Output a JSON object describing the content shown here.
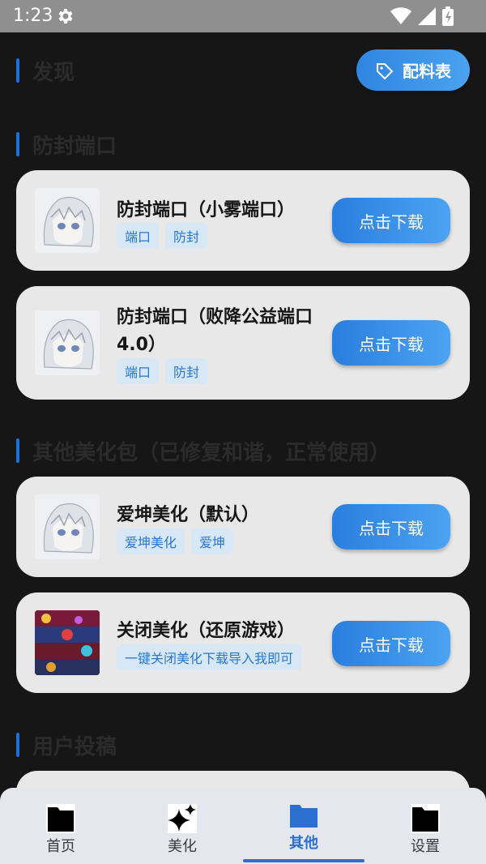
{
  "status_bar": {
    "time": "1:23",
    "icons": [
      "gear-icon",
      "wifi-icon",
      "signal-icon",
      "battery-icon"
    ]
  },
  "header": {
    "title": "发现",
    "formula_button": "配料表"
  },
  "sections": [
    {
      "title": "防封端口",
      "cards": [
        {
          "title": "防封端口（小雾端口）",
          "tags": [
            "端口",
            "防封"
          ],
          "button": "点击下载"
        },
        {
          "title": "防封端口（败降公益端口4.0）",
          "tags": [
            "端口",
            "防封"
          ],
          "button": "点击下载"
        }
      ]
    },
    {
      "title": "其他美化包（已修复和谐，正常使用）",
      "cards": [
        {
          "title": "爱坤美化（默认）",
          "tags": [
            "爱坤美化",
            "爱坤"
          ],
          "button": "点击下载"
        },
        {
          "title": "关闭美化（还原游戏）",
          "tags": [
            "一键关闭美化下载导入我即可"
          ],
          "button": "点击下载"
        }
      ]
    },
    {
      "title": "用户投稿",
      "cards": []
    }
  ],
  "bottom_nav": [
    {
      "label": "首页",
      "icon": "folder-icon",
      "active": false
    },
    {
      "label": "美化",
      "icon": "sparkle-icon",
      "active": false
    },
    {
      "label": "其他",
      "icon": "folder-icon",
      "active": true
    },
    {
      "label": "设置",
      "icon": "folder-icon",
      "active": false
    }
  ],
  "colors": {
    "accent": "#2b6fd0",
    "background": "#161616",
    "card": "#e8e8e8"
  }
}
